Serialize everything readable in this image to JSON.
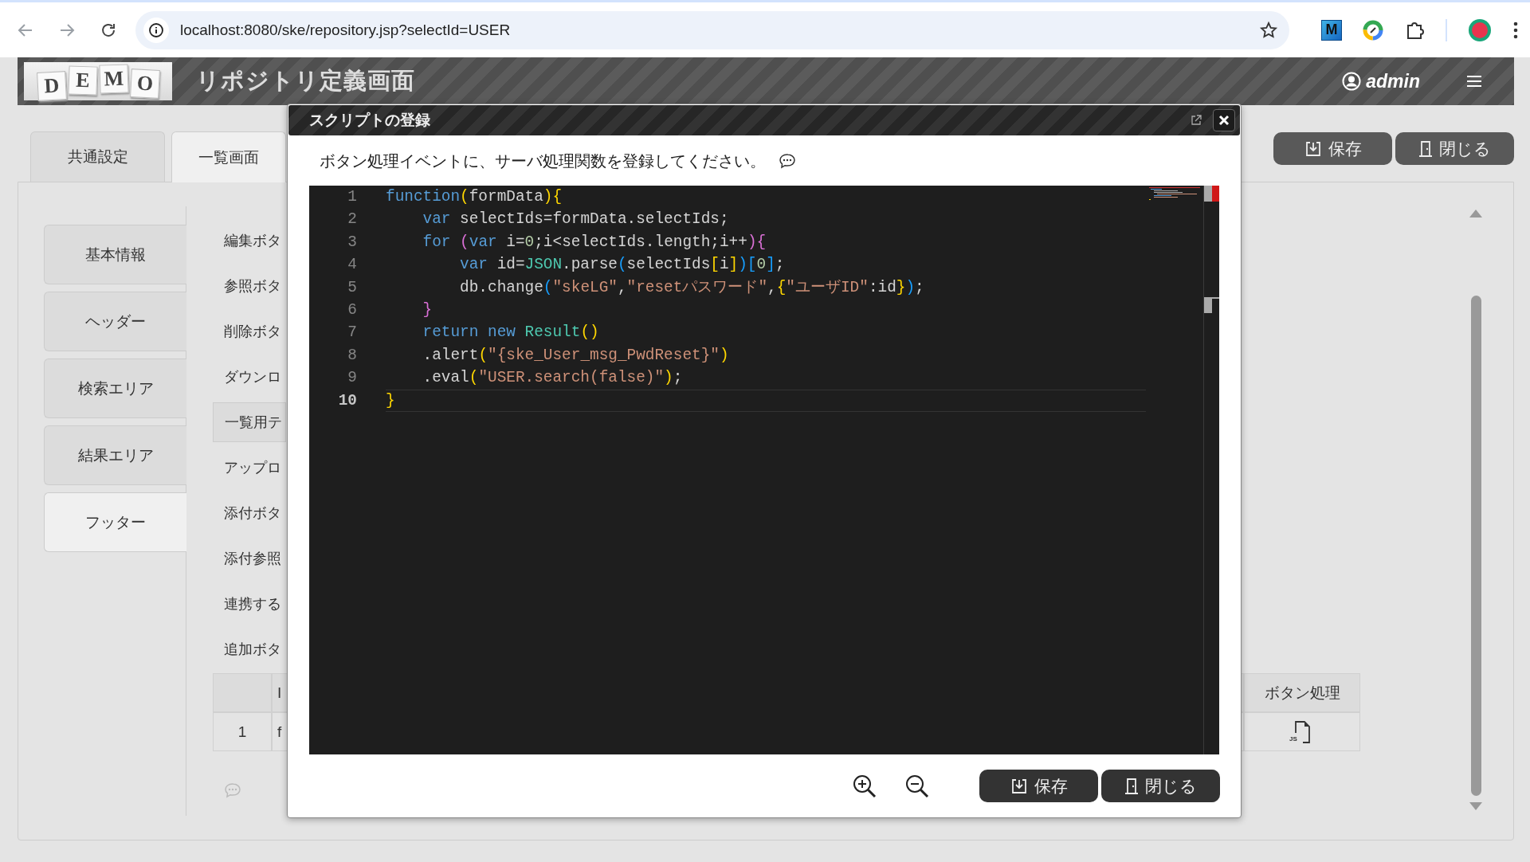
{
  "browser": {
    "url": "localhost:8080/ske/repository.jsp?selectId=USER",
    "extension_label": "M"
  },
  "header": {
    "logo_letters": [
      "D",
      "E",
      "M",
      "O"
    ],
    "title": "リポジトリ定義画面",
    "user": "admin"
  },
  "tabs": [
    {
      "label": "共通設定",
      "selected": false
    },
    {
      "label": "一覧画面",
      "selected": true
    }
  ],
  "toolbar_buttons": [
    {
      "label": "保存",
      "kind": "save"
    },
    {
      "label": "閉じる",
      "kind": "close"
    }
  ],
  "sections": [
    {
      "label": "基本情報",
      "selected": false
    },
    {
      "label": "ヘッダー",
      "selected": false
    },
    {
      "label": "検索エリア",
      "selected": false
    },
    {
      "label": "結果エリア",
      "selected": false
    },
    {
      "label": "フッター",
      "selected": true
    }
  ],
  "settings": [
    {
      "label": "編集ボタ",
      "kind": "label"
    },
    {
      "label": "参照ボタ",
      "kind": "label"
    },
    {
      "label": "削除ボタ",
      "kind": "label"
    },
    {
      "label": "ダウンロ",
      "kind": "label"
    },
    {
      "label": "一覧用テ",
      "kind": "group"
    },
    {
      "label": "アップロ",
      "kind": "label"
    },
    {
      "label": "添付ボタ",
      "kind": "label"
    },
    {
      "label": "添付参照",
      "kind": "label"
    },
    {
      "label": "連携する",
      "kind": "label"
    },
    {
      "label": "追加ボタ",
      "kind": "label"
    }
  ],
  "table": {
    "columns": [
      "I",
      "ボタン処理"
    ],
    "rows": [
      {
        "index": "1",
        "id": "f",
        "script_badge": "JS"
      }
    ]
  },
  "dialog": {
    "title": "スクリプトの登録",
    "message": "ボタン処理イベントに、サーバ処理関数を登録してください。",
    "code": [
      {
        "number": "1",
        "current": false,
        "tokens": [
          {
            "kind": "keyword",
            "text": "function"
          },
          {
            "kind": "bracket-gold",
            "text": "("
          },
          {
            "kind": "plain",
            "text": "formData"
          },
          {
            "kind": "bracket-gold",
            "text": ")"
          },
          {
            "kind": "bracket-gold",
            "text": "{"
          }
        ]
      },
      {
        "number": "2",
        "current": false,
        "tokens": [
          {
            "kind": "keyword",
            "text": "    var"
          },
          {
            "kind": "plain",
            "text": " selectIds=formData.selectIds;"
          }
        ]
      },
      {
        "number": "3",
        "current": false,
        "tokens": [
          {
            "kind": "keyword",
            "text": "    for"
          },
          {
            "kind": "bracket-purple",
            "text": " ("
          },
          {
            "kind": "keyword",
            "text": "var"
          },
          {
            "kind": "plain",
            "text": " i="
          },
          {
            "kind": "number",
            "text": "0"
          },
          {
            "kind": "plain",
            "text": ";i<selectIds.length;i++"
          },
          {
            "kind": "bracket-purple",
            "text": ")"
          },
          {
            "kind": "bracket-purple",
            "text": "{"
          }
        ]
      },
      {
        "number": "4",
        "current": false,
        "tokens": [
          {
            "kind": "keyword",
            "text": "        var"
          },
          {
            "kind": "plain",
            "text": " id="
          },
          {
            "kind": "type",
            "text": "JSON"
          },
          {
            "kind": "plain",
            "text": ".parse"
          },
          {
            "kind": "bracket-blue",
            "text": "("
          },
          {
            "kind": "plain",
            "text": "selectIds"
          },
          {
            "kind": "bracket-gold",
            "text": "["
          },
          {
            "kind": "plain",
            "text": "i"
          },
          {
            "kind": "bracket-gold",
            "text": "]"
          },
          {
            "kind": "bracket-blue",
            "text": ")"
          },
          {
            "kind": "bracket-blue",
            "text": "["
          },
          {
            "kind": "number",
            "text": "0"
          },
          {
            "kind": "bracket-blue",
            "text": "]"
          },
          {
            "kind": "plain",
            "text": ";"
          }
        ]
      },
      {
        "number": "5",
        "current": false,
        "tokens": [
          {
            "kind": "plain",
            "text": "        db.change"
          },
          {
            "kind": "bracket-blue",
            "text": "("
          },
          {
            "kind": "string",
            "text": "\"skeLG\""
          },
          {
            "kind": "plain",
            "text": ","
          },
          {
            "kind": "string",
            "text": "\"resetパスワード\""
          },
          {
            "kind": "plain",
            "text": ","
          },
          {
            "kind": "bracket-gold",
            "text": "{"
          },
          {
            "kind": "string",
            "text": "\"ユーザID\""
          },
          {
            "kind": "plain",
            "text": ":id"
          },
          {
            "kind": "bracket-gold",
            "text": "}"
          },
          {
            "kind": "bracket-blue",
            "text": ")"
          },
          {
            "kind": "plain",
            "text": ";"
          }
        ]
      },
      {
        "number": "6",
        "current": false,
        "tokens": [
          {
            "kind": "bracket-purple",
            "text": "    }"
          }
        ]
      },
      {
        "number": "7",
        "current": false,
        "tokens": [
          {
            "kind": "keyword",
            "text": "    return new"
          },
          {
            "kind": "type",
            "text": " Result"
          },
          {
            "kind": "bracket-gold",
            "text": "()"
          }
        ]
      },
      {
        "number": "8",
        "current": false,
        "tokens": [
          {
            "kind": "plain",
            "text": "    .alert"
          },
          {
            "kind": "bracket-gold",
            "text": "("
          },
          {
            "kind": "string",
            "text": "\"{ske_User_msg_PwdReset}\""
          },
          {
            "kind": "bracket-gold",
            "text": ")"
          }
        ]
      },
      {
        "number": "9",
        "current": false,
        "tokens": [
          {
            "kind": "plain",
            "text": "    .eval"
          },
          {
            "kind": "bracket-gold",
            "text": "("
          },
          {
            "kind": "string",
            "text": "\"USER.search(false)\""
          },
          {
            "kind": "bracket-gold",
            "text": ")"
          },
          {
            "kind": "plain",
            "text": ";"
          }
        ]
      },
      {
        "number": "10",
        "current": true,
        "tokens": [
          {
            "kind": "bracket-gold",
            "text": "}"
          }
        ]
      }
    ],
    "buttons": [
      {
        "label": "保存",
        "kind": "save"
      },
      {
        "label": "閉じる",
        "kind": "close"
      }
    ]
  }
}
